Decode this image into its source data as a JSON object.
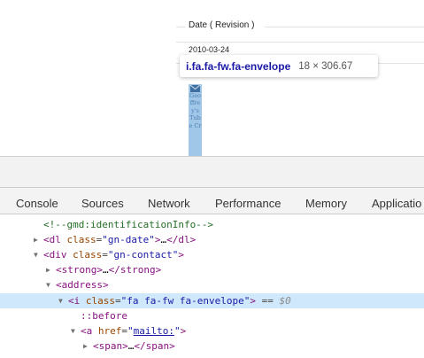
{
  "page": {
    "section_label": "Date ( Revision )",
    "section_value": "2010-03-24",
    "highlight_text": "Geoffrey's Tube Cr"
  },
  "tooltip": {
    "selector": "i.fa.fa-fw.fa-envelope",
    "size": "18 × 306.67"
  },
  "tabs": [
    "Console",
    "Sources",
    "Network",
    "Performance",
    "Memory",
    "Applicatio"
  ],
  "dom": {
    "comment": "<!--gmd:identificationInfo-->",
    "dl_tag": "dl",
    "dl_class_attr": "class",
    "dl_class_val": "gn-date",
    "div_tag": "div",
    "div_class_attr": "class",
    "div_class_val": "gn-contact",
    "strong_tag": "strong",
    "address_tag": "address",
    "i_tag": "i",
    "i_class_attr": "class",
    "i_class_val": "fa fa-fw fa-envelope",
    "eq_text": "==",
    "dollar_text": "$0",
    "before_text": "::before",
    "a_tag": "a",
    "a_href_attr": "href",
    "a_href_val": "mailto:",
    "span_tag": "span",
    "ellipsis": "…"
  },
  "colors": {
    "highlight": "#6fa8dc",
    "selection": "#cfe8fc",
    "tag": "#881280",
    "attribute": "#994500",
    "value": "#1a1aa6",
    "comment": "#236e25"
  }
}
